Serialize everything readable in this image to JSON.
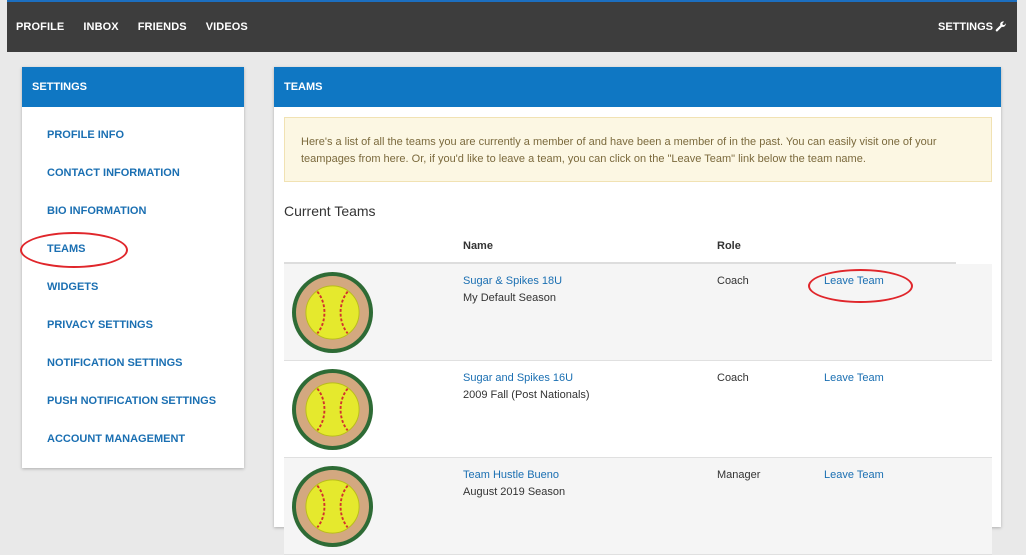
{
  "topnav": {
    "items": [
      "PROFILE",
      "INBOX",
      "FRIENDS",
      "VIDEOS"
    ],
    "settings_label": "SETTINGS"
  },
  "sidebar": {
    "title": "SETTINGS",
    "items": [
      {
        "label": "PROFILE INFO"
      },
      {
        "label": "CONTACT INFORMATION"
      },
      {
        "label": "BIO INFORMATION"
      },
      {
        "label": "TEAMS"
      },
      {
        "label": "WIDGETS"
      },
      {
        "label": "PRIVACY SETTINGS"
      },
      {
        "label": "NOTIFICATION SETTINGS"
      },
      {
        "label": "PUSH NOTIFICATION SETTINGS"
      },
      {
        "label": "ACCOUNT MANAGEMENT"
      }
    ]
  },
  "main": {
    "title": "TEAMS",
    "info": "Here's a list of all the teams you are currently a member of and have been a member of in the past. You can easily visit one of your teampages from here. Or, if you'd like to leave a team, you can click on the \"Leave Team\" link below the team name.",
    "section_title": "Current Teams",
    "columns": {
      "name": "Name",
      "role": "Role"
    },
    "teams": [
      {
        "name": "Sugar & Spikes 18U",
        "season": "My Default Season",
        "role": "Coach",
        "action": "Leave Team"
      },
      {
        "name": "Sugar and Spikes 16U",
        "season": "2009 Fall (Post Nationals)",
        "role": "Coach",
        "action": "Leave Team"
      },
      {
        "name": "Team Hustle Bueno",
        "season": "August 2019 Season",
        "role": "Manager",
        "action": "Leave Team"
      }
    ]
  },
  "colors": {
    "topbar": "#3d3d3d",
    "accent": "#0f77c3",
    "link": "#1a6fb2",
    "annotation": "#e0262b"
  }
}
